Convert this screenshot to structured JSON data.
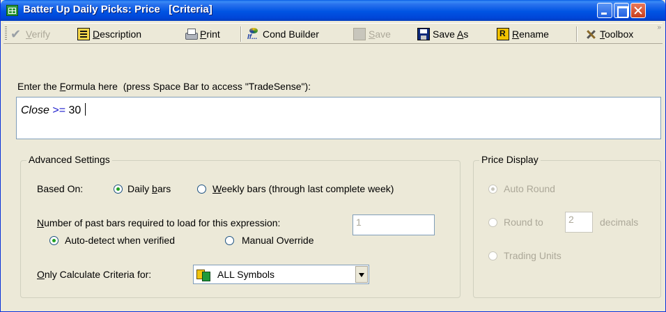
{
  "window": {
    "title": "Batter Up Daily Picks: Price   [Criteria]"
  },
  "toolbar": {
    "verify": {
      "pre": "",
      "key": "V",
      "post": "erify"
    },
    "description": {
      "pre": "",
      "key": "D",
      "post": "escription"
    },
    "print": {
      "pre": "",
      "key": "P",
      "post": "rint"
    },
    "cond_builder": "Cond Builder",
    "cond_icon_text": "If...",
    "save": {
      "pre": "",
      "key": "S",
      "post": "ave"
    },
    "save_as": {
      "pre": "Save ",
      "key": "A",
      "post": "s"
    },
    "rename": {
      "pre": "",
      "key": "R",
      "post": "ename"
    },
    "toolbox": {
      "pre": "",
      "key": "T",
      "post": "oolbox"
    },
    "more": "»"
  },
  "formula": {
    "label_pre": "Enter the ",
    "label_key": "F",
    "label_post": "ormula here  (press Space Bar to access \"TradeSense\"):",
    "expr_keyword": "Close",
    "expr_operator": " >= ",
    "expr_value": "30"
  },
  "advanced": {
    "title": "Advanced Settings",
    "based_on_label": "Based On:",
    "daily_pre": "Daily ",
    "daily_key": "b",
    "daily_post": "ars",
    "weekly_key": "W",
    "weekly_post": "eekly bars  (through last complete week)",
    "past_bars_key": "N",
    "past_bars_post": "umber of past bars required to load for this expression:",
    "past_bars_value": "1",
    "auto_detect": "Auto-detect when verified",
    "manual_override": "Manual Override",
    "calc_key": "O",
    "calc_post": "nly Calculate Criteria for:",
    "symbols_value": "ALL Symbols"
  },
  "price_display": {
    "title": "Price Display",
    "auto_round": "Auto Round",
    "round_to": "Round to",
    "round_value": "2",
    "decimals": "decimals",
    "trading_units": "Trading Units"
  }
}
